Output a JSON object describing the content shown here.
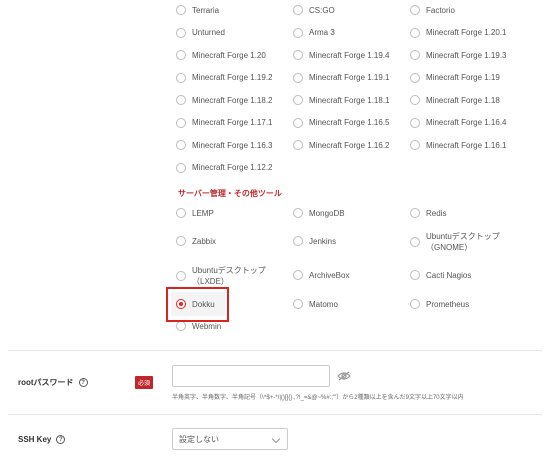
{
  "games": {
    "rows": [
      [
        "Terraria",
        "CS:GO",
        "Factorio"
      ],
      [
        "Unturned",
        "Arma 3",
        "Minecraft Forge 1.20.1"
      ],
      [
        "Minecraft Forge 1.20",
        "Minecraft Forge 1.19.4",
        "Minecraft Forge 1.19.3"
      ],
      [
        "Minecraft Forge 1.19.2",
        "Minecraft Forge 1.19.1",
        "Minecraft Forge 1.19"
      ],
      [
        "Minecraft Forge 1.18.2",
        "Minecraft Forge 1.18.1",
        "Minecraft Forge 1.18"
      ],
      [
        "Minecraft Forge 1.17.1",
        "Minecraft Forge 1.16.5",
        "Minecraft Forge 1.16.4"
      ],
      [
        "Minecraft Forge 1.16.3",
        "Minecraft Forge 1.16.2",
        "Minecraft Forge 1.16.1"
      ],
      [
        "Minecraft Forge 1.12.2"
      ]
    ]
  },
  "tools": {
    "title": "サーバー管理・その他ツール",
    "rows": [
      [
        "LEMP",
        "MongoDB",
        "Redis"
      ],
      [
        "Zabbix",
        "Jenkins",
        "Ubuntuデスクトップ（GNOME）"
      ],
      [
        "Ubuntuデスクトップ（LXDE）",
        "ArchiveBox",
        "Cacti Nagios"
      ],
      [
        "Dokku",
        "Matomo",
        "Prometheus"
      ],
      [
        "Webmin"
      ]
    ],
    "selected": "Dokku"
  },
  "root_password": {
    "label": "rootパスワード",
    "required_badge": "必須",
    "value": "",
    "hint": "半角英字、半角数字、半角記号（\\^$+-*/|()[]{}.,?!_=&@~%#:;'\"）から2種類以上を含んだ9文字以上70文字以内"
  },
  "ssh_key": {
    "label": "SSH Key",
    "selected_value": "設定しない"
  },
  "icons": {
    "help": "help-circle-icon",
    "password_visibility": "eye-off-icon",
    "dropdown": "chevron-down-icon"
  },
  "colors": {
    "accent": "#c0272d",
    "radio_selected": "#e0242a",
    "highlight_box": "#d9241f"
  }
}
